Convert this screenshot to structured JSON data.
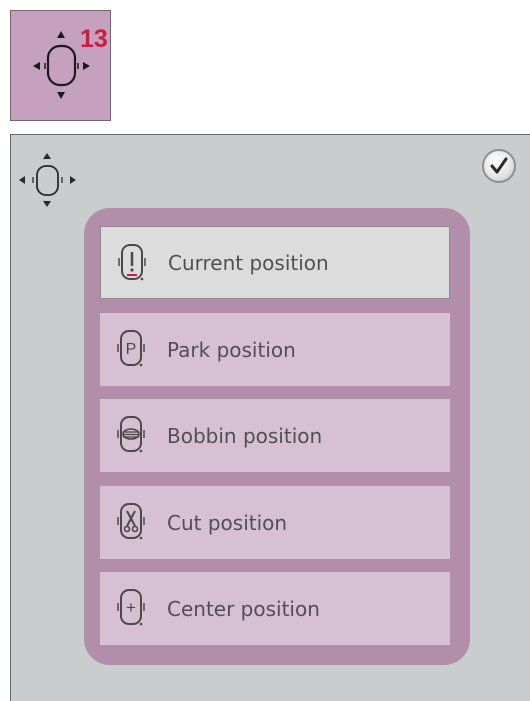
{
  "callout": {
    "number": "13"
  },
  "menu": {
    "items": [
      {
        "label": "Current position",
        "icon": "current-position-icon",
        "selected": true
      },
      {
        "label": "Park position",
        "icon": "park-position-icon",
        "letter": "P"
      },
      {
        "label": "Bobbin position",
        "icon": "bobbin-position-icon"
      },
      {
        "label": "Cut position",
        "icon": "cut-position-icon"
      },
      {
        "label": "Center position",
        "icon": "center-position-icon",
        "symbol": "+"
      }
    ]
  },
  "colors": {
    "tile_background": "#c6a0bf",
    "panel_background": "#c9cdcd",
    "menu_frame": "#b28eab",
    "menu_item": "#d7bfd4",
    "menu_item_selected": "#dcdcdc",
    "callout_red": "#cf1b3a"
  }
}
